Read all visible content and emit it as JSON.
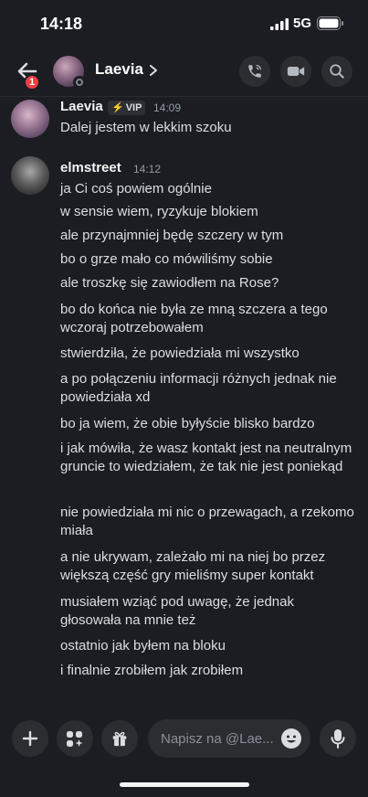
{
  "status_bar": {
    "time": "14:18",
    "network": "5G"
  },
  "header": {
    "name": "Laevia",
    "badge_count": "1"
  },
  "messages": [
    {
      "author": "Laevia",
      "badge": "VIP",
      "time": "14:09",
      "lines": [
        "Dalej jestem w lekkim szoku"
      ]
    },
    {
      "author": "elmstreet",
      "time": "14:12",
      "lines": [
        "ja Ci coś powiem ogólnie",
        "w sensie wiem, ryzykuje blokiem",
        "ale przynajmniej będę szczery w tym",
        "bo o grze mało co mówiliśmy sobie",
        "ale troszkę się zawiodłem na Rose?",
        "bo do końca nie była ze mną szczera a tego wczoraj potrzebowałem",
        "stwierdziła, że powiedziała mi wszystko",
        "a po połączeniu informacji różnych jednak nie powiedziała xd",
        "bo ja wiem, że obie byłyście blisko bardzo",
        "i jak mówiła, że wasz kontakt jest na neutralnym gruncie to wiedziałem, że tak nie jest poniekąd",
        "nie powiedziała mi nic o przewagach, a rzekomo miała",
        "a nie ukrywam, zależało mi na niej bo przez większą część gry mieliśmy super kontakt",
        "musiałem wziąć pod uwagę, że jednak głosowała na mnie też",
        "ostatnio jak byłem na bloku",
        "i finalnie zrobiłem jak zrobiłem"
      ]
    }
  ],
  "composer": {
    "placeholder": "Napisz na @Lae..."
  },
  "icons": {
    "back": "arrow-left-icon",
    "call": "phone-icon",
    "video": "video-camera-icon",
    "search": "search-icon",
    "add": "plus-icon",
    "apps": "apps-icon",
    "gift": "gift-icon",
    "emoji": "emoji-icon",
    "mic": "microphone-icon"
  },
  "colors": {
    "background": "#1c1d22",
    "badge": "#f23f43",
    "vip_bolt": "#f0b232"
  }
}
